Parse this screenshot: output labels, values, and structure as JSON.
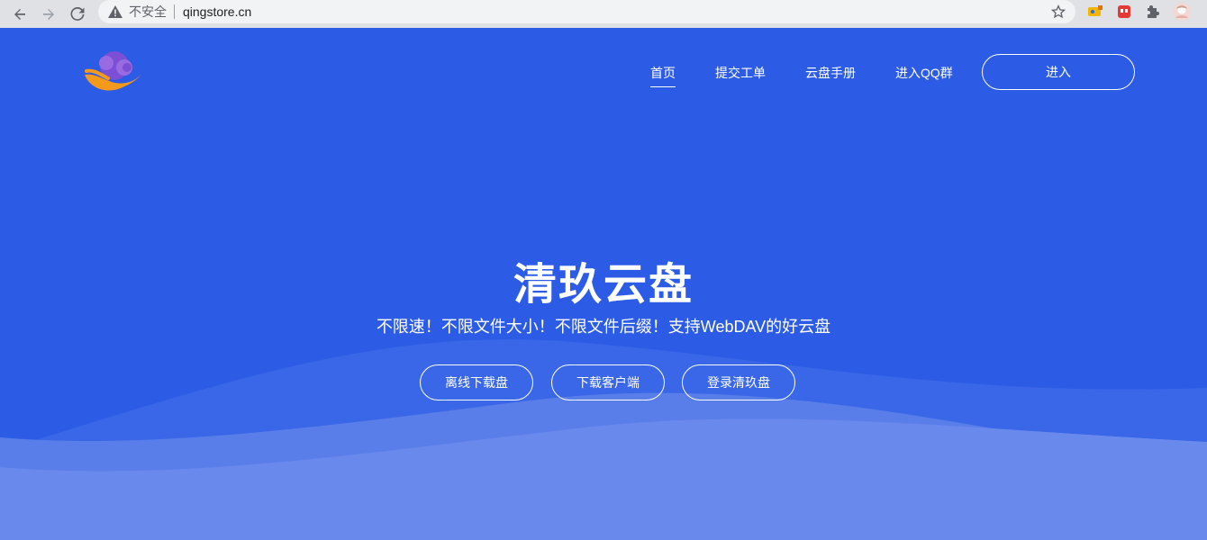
{
  "browser": {
    "insecure_label": "不安全",
    "url": "qingstore.cn",
    "icons": [
      "back-icon",
      "forward-icon",
      "reload-icon",
      "warning-icon",
      "star-icon",
      "extension-icon",
      "puzzle-icon",
      "profile-avatar"
    ]
  },
  "header": {
    "nav": [
      {
        "label": "首页",
        "active": true
      },
      {
        "label": "提交工单",
        "active": false
      },
      {
        "label": "云盘手册",
        "active": false
      },
      {
        "label": "进入QQ群",
        "active": false
      }
    ],
    "enter_label": "进入"
  },
  "hero": {
    "title": "清玖云盘",
    "subtitle": "不限速！不限文件大小！不限文件后缀！支持WebDAV的好云盘",
    "buttons": [
      "离线下载盘",
      "下载客户端",
      "登录清玖盘"
    ]
  },
  "colors": {
    "background": "#2c5be6",
    "wave_light": "#6a89ec",
    "text": "#ffffff"
  }
}
